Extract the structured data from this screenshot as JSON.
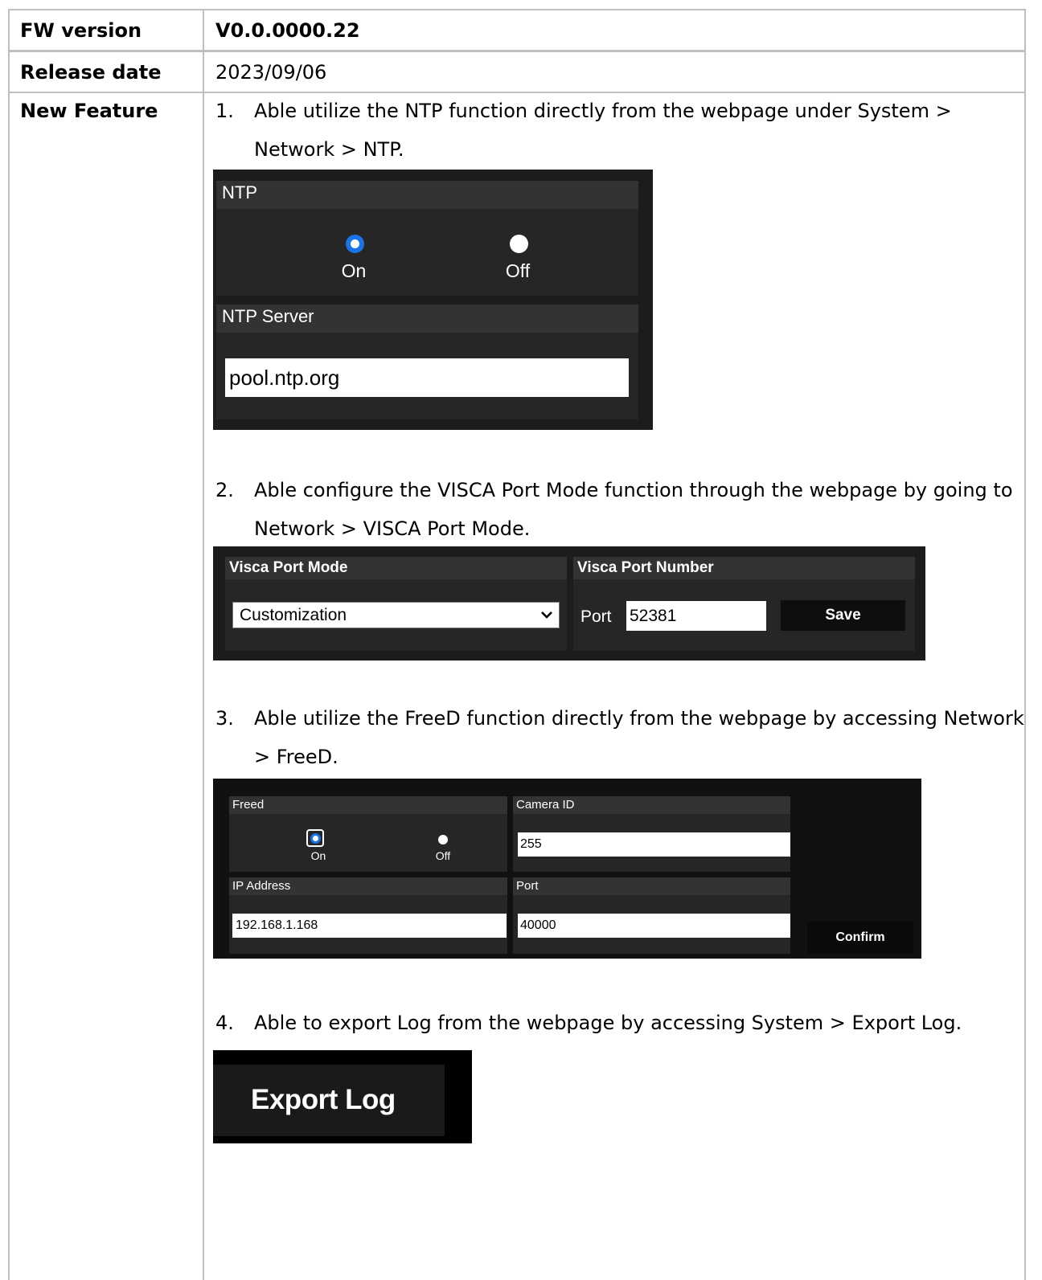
{
  "table": {
    "fw_label": "FW version",
    "fw_value": "V0.0.0000.22",
    "date_label": "Release date",
    "date_value": "2023/09/06",
    "feature_label": "New Feature"
  },
  "features": [
    {
      "num": "1.",
      "text": "Able utilize the NTP function directly from the webpage under System > Network > NTP."
    },
    {
      "num": "2.",
      "text": "Able configure the VISCA Port Mode function through the webpage by going to Network > VISCA Port Mode."
    },
    {
      "num": "3.",
      "text": "Able utilize the FreeD function directly from the webpage by accessing Network > FreeD."
    },
    {
      "num": "4.",
      "text": "Able to export Log from the webpage by accessing System > Export Log."
    }
  ],
  "ntp": {
    "title": "NTP",
    "on_label": "On",
    "off_label": "Off",
    "selected": "On",
    "server_title": "NTP Server",
    "server_value": "pool.ntp.org"
  },
  "visca": {
    "mode_title": "Visca Port Mode",
    "mode_value": "Customization",
    "port_title": "Visca Port Number",
    "port_label": "Port",
    "port_value": "52381",
    "save_label": "Save"
  },
  "freed": {
    "title": "Freed",
    "on_label": "On",
    "off_label": "Off",
    "selected": "On",
    "camera_id_title": "Camera ID",
    "camera_id_value": "255",
    "ip_title": "IP Address",
    "ip_value": "192.168.1.168",
    "port_title": "Port",
    "port_value": "40000",
    "confirm_label": "Confirm"
  },
  "export": {
    "label": "Export Log"
  },
  "colors": {
    "accent_radio": "#1a73e8",
    "panel_bg": "#1c1c1c",
    "section_header": "#333333",
    "grid_line": "#bfbfbf"
  }
}
